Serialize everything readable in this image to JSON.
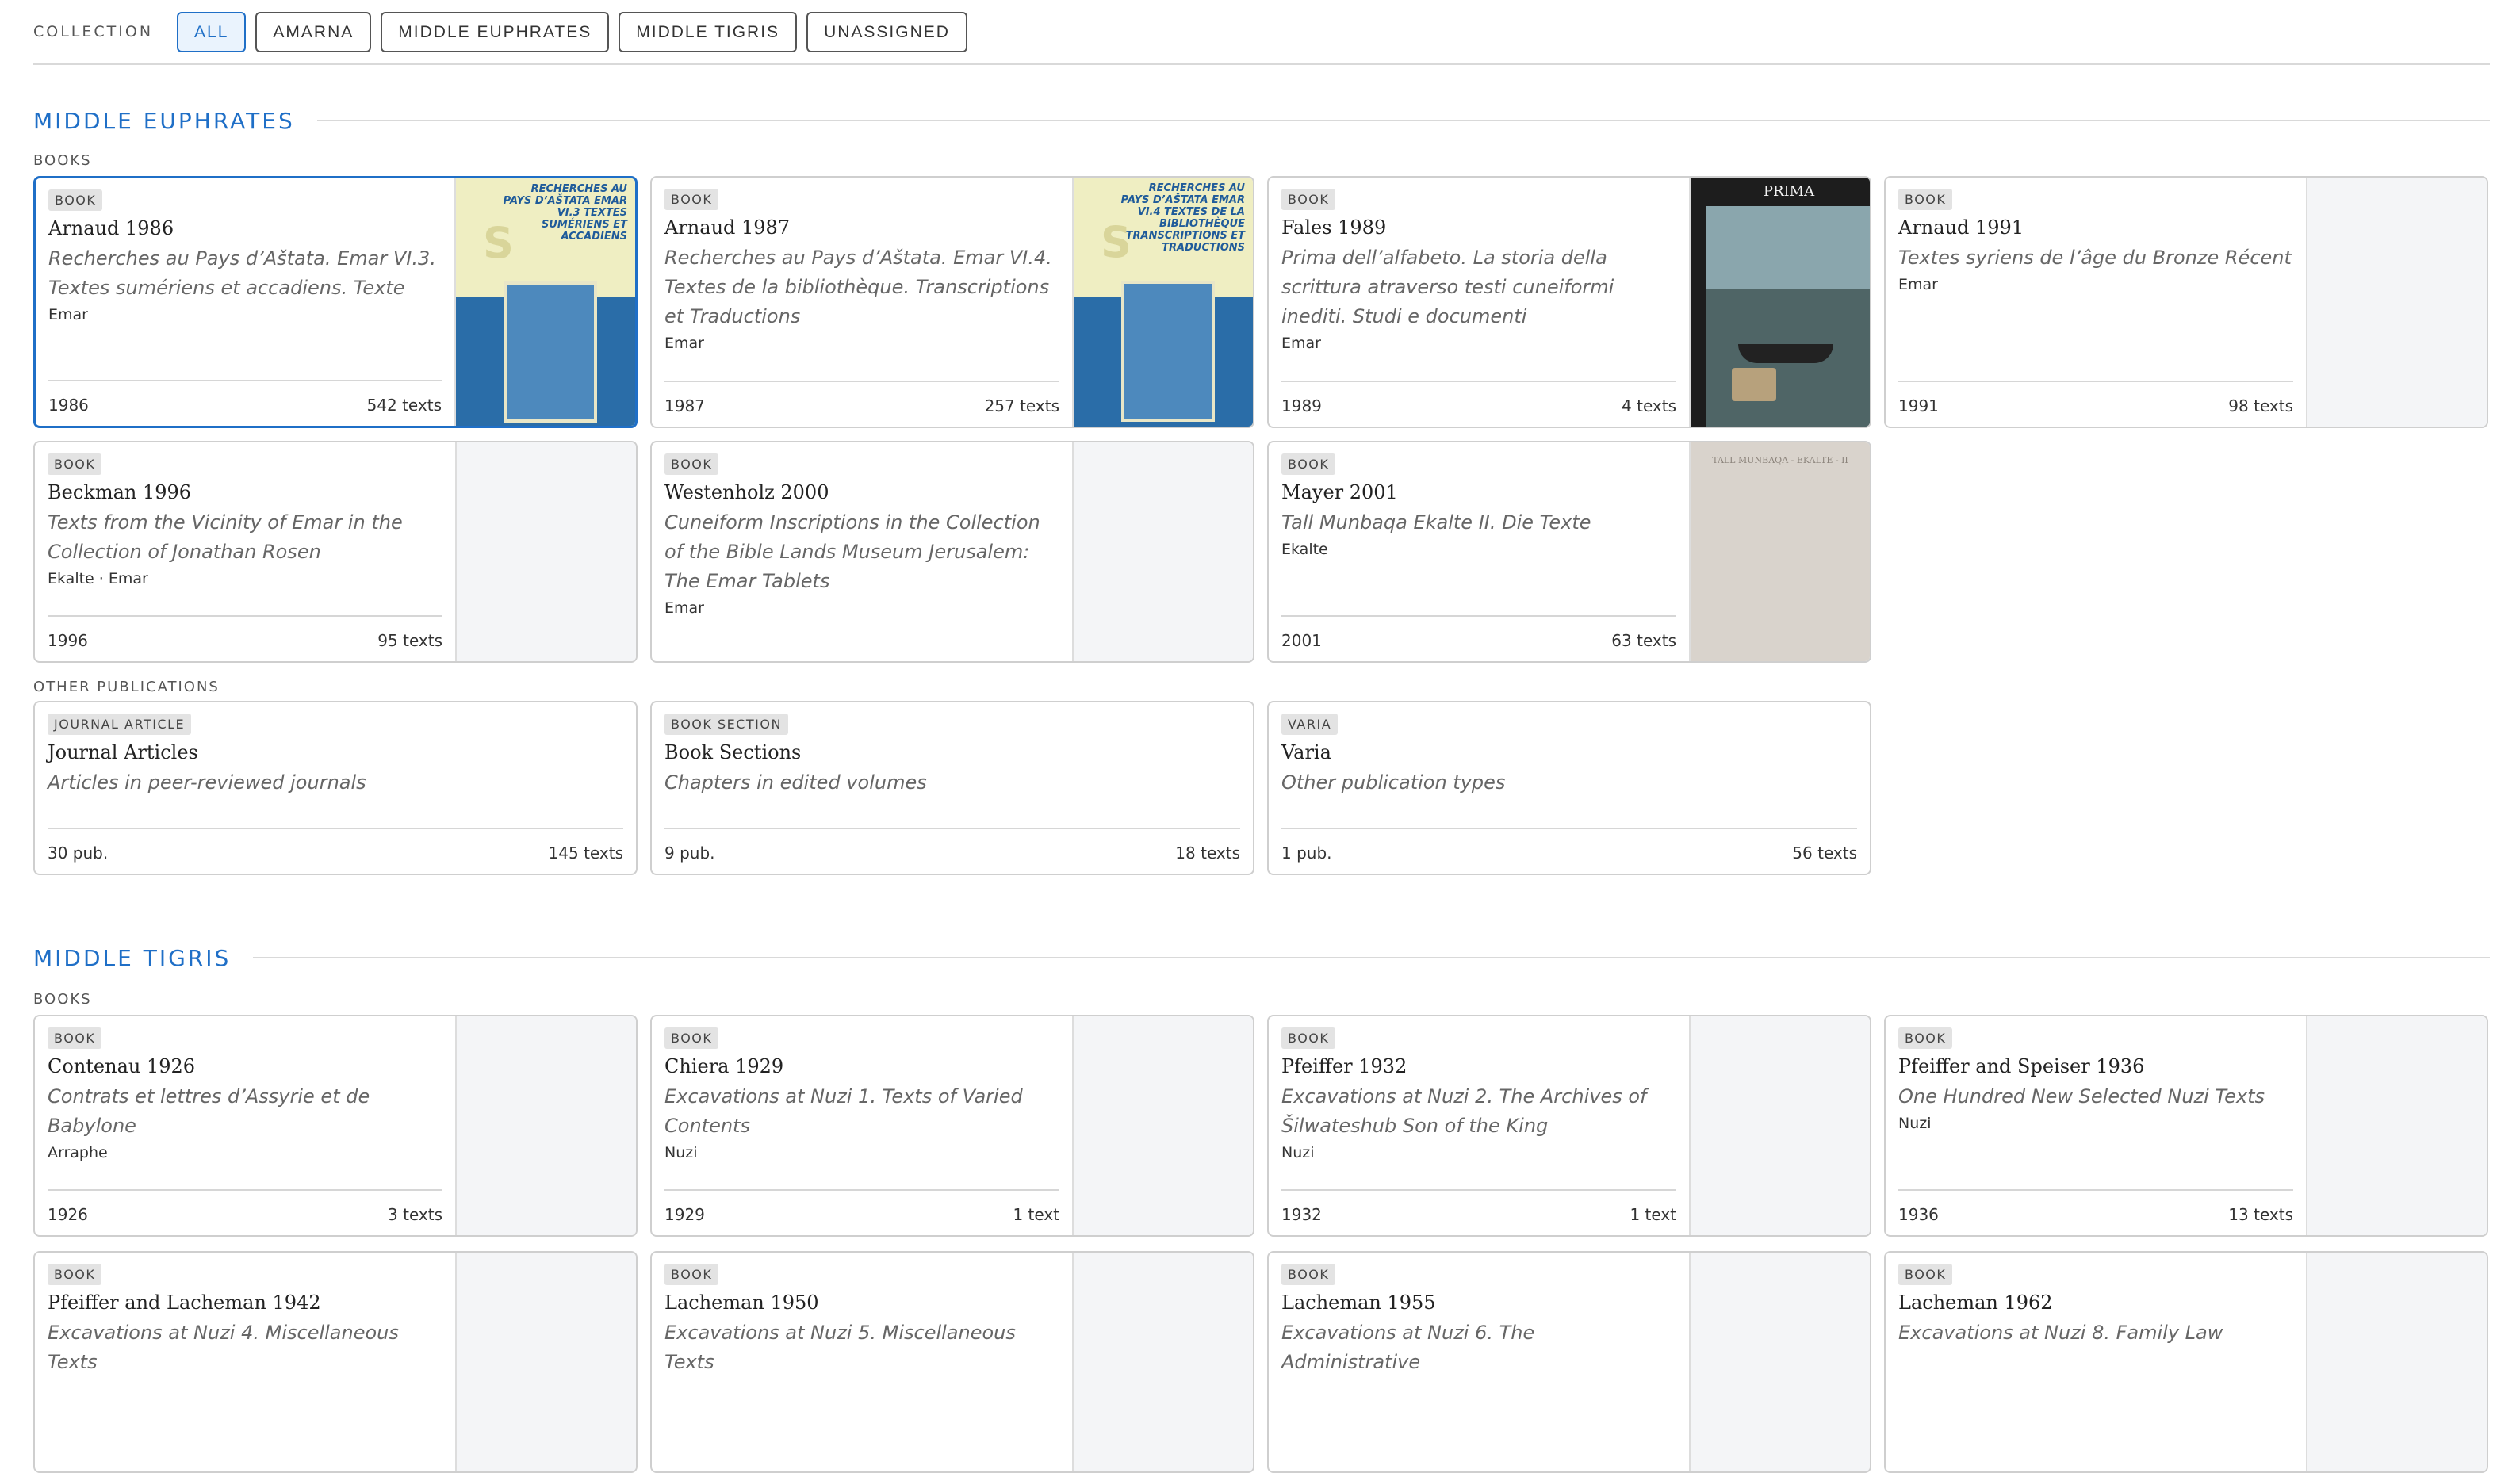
{
  "filter": {
    "label": "COLLECTION",
    "chips": [
      "ALL",
      "AMARNA",
      "MIDDLE EUPHRATES",
      "MIDDLE TIGRIS",
      "UNASSIGNED"
    ],
    "active_index": 0
  },
  "sections": [
    {
      "title": "MIDDLE EUPHRATES",
      "books_label": "BOOKS",
      "books": [
        {
          "badge": "BOOK",
          "title": "Arnaud 1986",
          "desc": "Recherches au Pays d’Aštata. Emar VI.3. Textes sumériens et accadiens. Texte",
          "place": "Emar",
          "year": "1986",
          "count": "542 texts",
          "cover": "yellow"
        },
        {
          "badge": "BOOK",
          "title": "Arnaud 1987",
          "desc": "Recherches au Pays d’Aštata. Emar VI.4. Textes de la bibliothèque. Transcriptions et Traductions",
          "place": "Emar",
          "year": "1987",
          "count": "257 texts",
          "cover": "yellow"
        },
        {
          "badge": "BOOK",
          "title": "Fales 1989",
          "desc": "Prima dell’alfabeto. La storia della scrittura atraverso testi cuneiformi inediti. Studi e documenti",
          "place": "Emar",
          "year": "1989",
          "count": "4 texts",
          "cover": "photo"
        },
        {
          "badge": "BOOK",
          "title": "Arnaud 1991",
          "desc": "Textes syriens de l’âge du Bronze Récent",
          "place": "Emar",
          "year": "1991",
          "count": "98 texts",
          "cover": "none"
        },
        {
          "badge": "BOOK",
          "title": "Beckman 1996",
          "desc": "Texts from the Vicinity of Emar in the Collection of Jonathan Rosen",
          "place": "Ekalte · Emar",
          "year": "1996",
          "count": "95 texts",
          "cover": "none"
        },
        {
          "badge": "BOOK",
          "title": "Westenholz 2000",
          "desc": "Cuneiform Inscriptions in the Collection of the Bible Lands Museum Jerusalem: The Emar Tablets",
          "place": "Emar",
          "year": "",
          "count": "",
          "cover": "none"
        },
        {
          "badge": "BOOK",
          "title": "Mayer 2001",
          "desc": "Tall Munbaqa Ekalte II. Die Texte",
          "place": "Ekalte",
          "year": "2001",
          "count": "63 texts",
          "cover": "grey"
        }
      ],
      "other_label": "OTHER PUBLICATIONS",
      "others": [
        {
          "badge": "JOURNAL ARTICLE",
          "title": "Journal Articles",
          "desc": "Articles in peer-reviewed journals",
          "pubs": "30 pub.",
          "count": "145 texts"
        },
        {
          "badge": "BOOK SECTION",
          "title": "Book Sections",
          "desc": "Chapters in edited volumes",
          "pubs": "9 pub.",
          "count": "18 texts"
        },
        {
          "badge": "VARIA",
          "title": "Varia",
          "desc": "Other publication types",
          "pubs": "1 pub.",
          "count": "56 texts"
        }
      ]
    },
    {
      "title": "MIDDLE TIGRIS",
      "books_label": "BOOKS",
      "books": [
        {
          "badge": "BOOK",
          "title": "Contenau 1926",
          "desc": "Contrats et lettres d’Assyrie et de Babylone",
          "place": "Arraphe",
          "year": "1926",
          "count": "3 texts"
        },
        {
          "badge": "BOOK",
          "title": "Chiera 1929",
          "desc": "Excavations at Nuzi 1. Texts of Varied Contents",
          "place": "Nuzi",
          "year": "1929",
          "count": "1 text"
        },
        {
          "badge": "BOOK",
          "title": "Pfeiffer 1932",
          "desc": "Excavations at Nuzi 2. The Archives of Šilwateshub Son of the King",
          "place": "Nuzi",
          "year": "1932",
          "count": "1 text"
        },
        {
          "badge": "BOOK",
          "title": "Pfeiffer and Speiser 1936",
          "desc": "One Hundred New Selected Nuzi Texts",
          "place": "Nuzi",
          "year": "1936",
          "count": "13 texts"
        },
        {
          "badge": "BOOK",
          "title": "Pfeiffer and Lacheman 1942",
          "desc": "Excavations at Nuzi 4. Miscellaneous Texts",
          "place": "",
          "year": "",
          "count": ""
        },
        {
          "badge": "BOOK",
          "title": "Lacheman 1950",
          "desc": "Excavations at Nuzi 5. Miscellaneous Texts",
          "place": "",
          "year": "",
          "count": ""
        },
        {
          "badge": "BOOK",
          "title": "Lacheman 1955",
          "desc": "Excavations at Nuzi 6. The Administrative",
          "place": "",
          "year": "",
          "count": ""
        },
        {
          "badge": "BOOK",
          "title": "Lacheman 1962",
          "desc": "Excavations at Nuzi 8. Family Law",
          "place": "",
          "year": "",
          "count": ""
        }
      ]
    }
  ],
  "covers": {
    "arnaud_1986_text": "RECHERCHES AU PAYS D’AŠTATA EMAR VI.3 TEXTES SUMÉRIENS ET ACCADIENS",
    "arnaud_1987_text": "RECHERCHES AU PAYS D’AŠTATA EMAR VI.4 TEXTES DE LA BIBLIOTHÈQUE TRANSCRIPTIONS ET TRADUCTIONS",
    "fales_head": "PRIMA DELL’ALFABETO",
    "mayer_head": "TALL MUNBAQA - EKALTE - II"
  },
  "colors": {
    "accent": "#1f6fc7",
    "border": "#cfcfcf",
    "badge_bg": "#e3e3e3"
  }
}
